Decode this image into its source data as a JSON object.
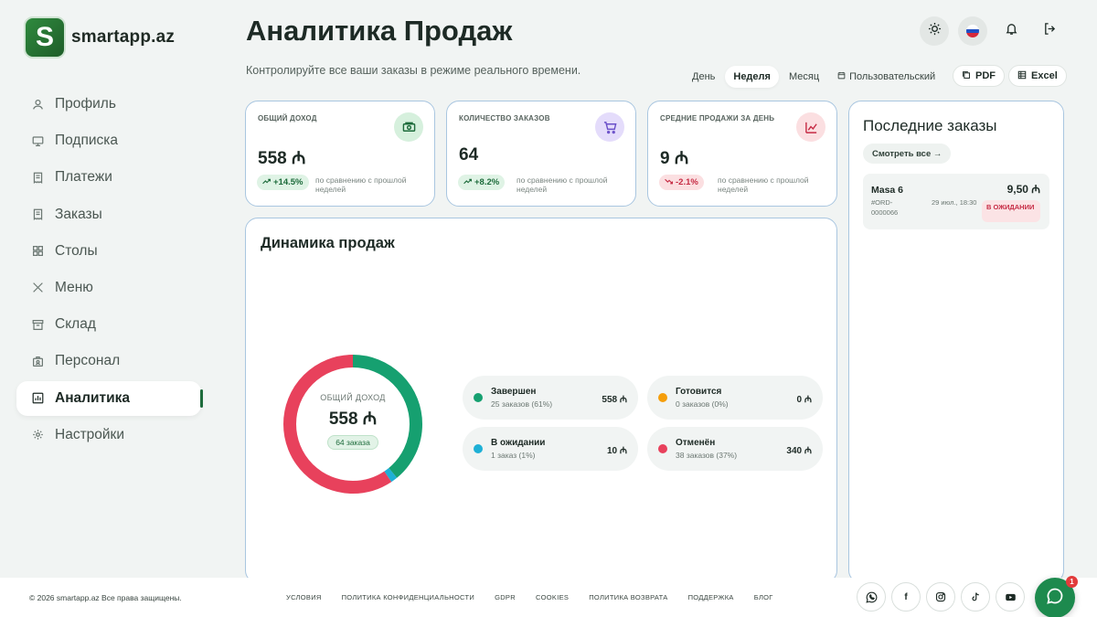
{
  "brand": {
    "logo_letter": "S",
    "name": "smartapp.az"
  },
  "sidebar": {
    "items": [
      {
        "label": "Профиль",
        "icon": "user-icon"
      },
      {
        "label": "Подписка",
        "icon": "monitor-icon"
      },
      {
        "label": "Платежи",
        "icon": "receipt-icon"
      },
      {
        "label": "Заказы",
        "icon": "receipt-icon"
      },
      {
        "label": "Столы",
        "icon": "grid-icon"
      },
      {
        "label": "Меню",
        "icon": "utensils-icon"
      },
      {
        "label": "Склад",
        "icon": "archive-icon"
      },
      {
        "label": "Персонал",
        "icon": "badge-icon"
      },
      {
        "label": "Аналитика",
        "icon": "chart-icon",
        "active": true
      },
      {
        "label": "Настройки",
        "icon": "gear-icon"
      }
    ]
  },
  "header": {
    "title": "Аналитика Продаж",
    "subtitle": "Контролируйте все ваши заказы в режиме реального времени.",
    "ranges": [
      "День",
      "Неделя",
      "Месяц",
      "Пользовательский"
    ],
    "selected_range": "Неделя",
    "export_pdf": "PDF",
    "export_excel": "Excel"
  },
  "stats": [
    {
      "label": "ОБЩИЙ ДОХОД",
      "value": "558 ₼",
      "change": "+14.5%",
      "note": "по сравнению с прошлой неделей",
      "trend": "up",
      "icon": "cash-icon",
      "icon_bg": "#d6f0dd",
      "icon_color": "#1d6b3b"
    },
    {
      "label": "КОЛИЧЕСТВО ЗАКАЗОВ",
      "value": "64",
      "change": "+8.2%",
      "note": "по сравнению с прошлой неделей",
      "trend": "up",
      "icon": "cart-icon",
      "icon_bg": "#e4dcfb",
      "icon_color": "#6a4fc9"
    },
    {
      "label": "СРЕДНИЕ ПРОДАЖИ ЗА ДЕНЬ",
      "value": "9 ₼",
      "change": "-2.1%",
      "note": "по сравнению с прошлой неделей",
      "trend": "down",
      "icon": "analytics-icon",
      "icon_bg": "#fbdfe1",
      "icon_color": "#c62b44"
    }
  ],
  "dynamics": {
    "title": "Динамика продаж",
    "center_label": "ОБЩИЙ ДОХОД",
    "center_value": "558 ₼",
    "center_pill": "64 заказа",
    "segments": [
      {
        "name": "Завершен",
        "count": "25 заказов (61%)",
        "amount": "558 ₼",
        "color": "#16a070",
        "orders": 25
      },
      {
        "name": "Готовится",
        "count": "0 заказов (0%)",
        "amount": "0 ₼",
        "color": "#f59e0b",
        "orders": 0
      },
      {
        "name": "В ожидании",
        "count": "1 заказ (1%)",
        "amount": "10 ₼",
        "color": "#1eb0d6",
        "orders": 1
      },
      {
        "name": "Отменён",
        "count": "38 заказов (37%)",
        "amount": "340 ₼",
        "color": "#e8415c",
        "orders": 38
      }
    ]
  },
  "orders": {
    "title": "Последние заказы",
    "see_all": "Смотреть все →",
    "items": [
      {
        "table": "Masa 6",
        "id": "#ORD-0000066",
        "date": "29 июл., 18:30",
        "amount": "9,50 ₼",
        "status": "В ОЖИДАНИИ"
      }
    ]
  },
  "footer": {
    "copyright": "© 2026 smartapp.az Все права защищены.",
    "links": [
      "УСЛОВИЯ",
      "ПОЛИТИКА КОНФИДЕНЦИАЛЬНОСТИ",
      "GDPR",
      "COOKIES",
      "ПОЛИТИКА ВОЗВРАТА",
      "ПОДДЕРЖКА",
      "БЛОГ"
    ],
    "socials": [
      "whatsapp-icon",
      "facebook-icon",
      "instagram-icon",
      "tiktok-icon",
      "youtube-icon"
    ],
    "chat_badge": "1"
  }
}
